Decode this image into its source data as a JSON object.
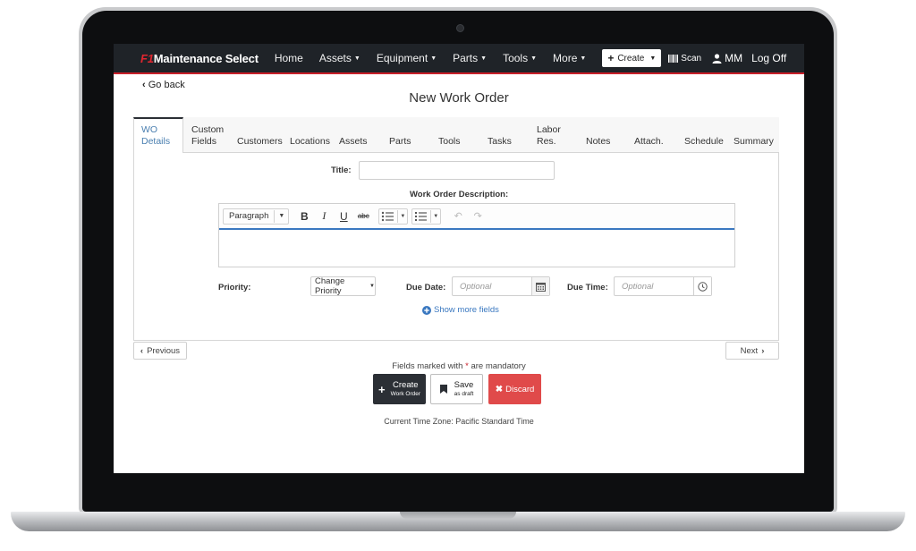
{
  "navbar": {
    "brand_f1": "F1",
    "brand_rest": "Maintenance Select",
    "items": [
      {
        "label": "Home",
        "dropdown": false
      },
      {
        "label": "Assets",
        "dropdown": true
      },
      {
        "label": "Equipment",
        "dropdown": true
      },
      {
        "label": "Parts",
        "dropdown": true
      },
      {
        "label": "Tools",
        "dropdown": true
      },
      {
        "label": "More",
        "dropdown": true
      }
    ],
    "create_label": "Create",
    "scan_label": "Scan",
    "user_initials": "MM",
    "logoff_label": "Log Off",
    "accent_color": "#c8202a"
  },
  "page": {
    "go_back": "Go back",
    "title": "New Work Order"
  },
  "tabs": [
    {
      "line1": "WO",
      "line2": "Details",
      "active": true
    },
    {
      "line1": "Custom",
      "line2": "Fields",
      "active": false
    },
    {
      "line1": "",
      "line2": "Customers",
      "active": false
    },
    {
      "line1": "",
      "line2": "Locations",
      "active": false
    },
    {
      "line1": "",
      "line2": "Assets",
      "active": false
    },
    {
      "line1": "",
      "line2": "Parts",
      "active": false
    },
    {
      "line1": "",
      "line2": "Tools",
      "active": false
    },
    {
      "line1": "",
      "line2": "Tasks",
      "active": false
    },
    {
      "line1": "Labor",
      "line2": "Res.",
      "active": false
    },
    {
      "line1": "",
      "line2": "Notes",
      "active": false
    },
    {
      "line1": "",
      "line2": "Attach.",
      "active": false
    },
    {
      "line1": "",
      "line2": "Schedule",
      "active": false
    },
    {
      "line1": "",
      "line2": "Summary",
      "active": false
    }
  ],
  "form": {
    "title_label": "Title:",
    "title_value": "",
    "description_label": "Work Order Description:",
    "editor": {
      "paragraph_label": "Paragraph",
      "bold": "B",
      "italic": "I",
      "underline": "U",
      "strike": "abc"
    },
    "priority_label": "Priority:",
    "priority_button": "Change Priority",
    "due_date_label": "Due Date:",
    "due_date_placeholder": "Optional",
    "due_time_label": "Due Time:",
    "due_time_placeholder": "Optional",
    "show_more": "Show more fields"
  },
  "pager": {
    "previous": "Previous",
    "next": "Next"
  },
  "footer": {
    "mandatory_prefix": "Fields marked with",
    "mandatory_star": "*",
    "mandatory_suffix": "are mandatory",
    "create_main": "Create",
    "create_sub": "Work Order",
    "save_main": "Save",
    "save_sub": "as draft",
    "discard": "Discard",
    "timezone": "Current Time Zone: Pacific Standard Time",
    "discard_color": "#e04a4a",
    "create_color": "#2b2f35"
  }
}
